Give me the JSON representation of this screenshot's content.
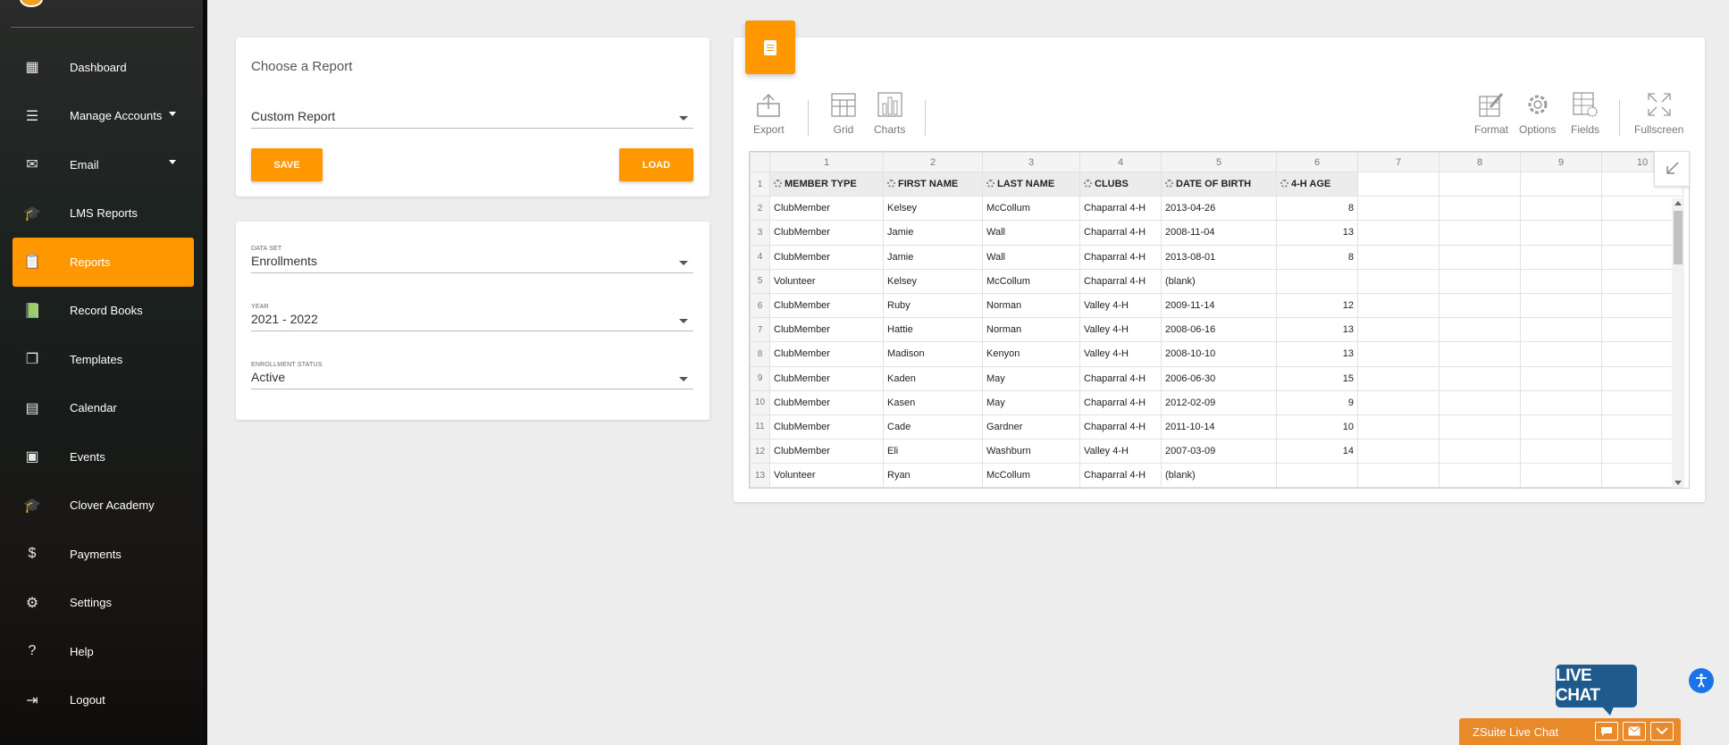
{
  "sidebar": {
    "items": [
      {
        "label": "Dashboard",
        "icon": "dashboard-icon"
      },
      {
        "label": "Manage Accounts",
        "icon": "list-icon",
        "has_caret": true
      },
      {
        "label": "Email",
        "icon": "mail-icon",
        "has_caret": true
      },
      {
        "label": "LMS Reports",
        "icon": "school-icon"
      },
      {
        "label": "Reports",
        "icon": "clipboard-icon",
        "active": true
      },
      {
        "label": "Record Books",
        "icon": "record-book-icon"
      },
      {
        "label": "Templates",
        "icon": "copy-icon"
      },
      {
        "label": "Calendar",
        "icon": "calendar-icon"
      },
      {
        "label": "Events",
        "icon": "event-icon"
      },
      {
        "label": "Clover Academy",
        "icon": "school-icon"
      },
      {
        "label": "Payments",
        "icon": "dollar-icon"
      },
      {
        "label": "Settings",
        "icon": "gear-icon"
      },
      {
        "label": "Help",
        "icon": "help-icon"
      },
      {
        "label": "Logout",
        "icon": "logout-icon"
      }
    ]
  },
  "choose": {
    "title": "Choose a Report",
    "selected": "Custom Report",
    "save_label": "SAVE",
    "load_label": "LOAD"
  },
  "filters": {
    "dataset_caption": "DATA SET",
    "dataset_value": "Enrollments",
    "year_caption": "YEAR",
    "year_value": "2021 - 2022",
    "status_caption": "ENROLLMENT STATUS",
    "status_value": "Active"
  },
  "toolbar": {
    "export": "Export",
    "grid": "Grid",
    "charts": "Charts",
    "format": "Format",
    "options": "Options",
    "fields": "Fields",
    "fullscreen": "Fullscreen"
  },
  "grid": {
    "col_numbers": [
      "1",
      "2",
      "3",
      "4",
      "5",
      "6",
      "7",
      "8",
      "9",
      "10"
    ],
    "headers": [
      "MEMBER TYPE",
      "FIRST NAME",
      "LAST NAME",
      "CLUBS",
      "DATE OF BIRTH",
      "4-H AGE"
    ],
    "rows": [
      {
        "n": "2",
        "c": [
          "ClubMember",
          "Kelsey",
          "McCollum",
          "Chaparral 4-H",
          "2013-04-26",
          "8"
        ]
      },
      {
        "n": "3",
        "c": [
          "ClubMember",
          "Jamie",
          "Wall",
          "Chaparral 4-H",
          "2008-11-04",
          "13"
        ]
      },
      {
        "n": "4",
        "c": [
          "ClubMember",
          "Jamie",
          "Wall",
          "Chaparral 4-H",
          "2013-08-01",
          "8"
        ]
      },
      {
        "n": "5",
        "c": [
          "Volunteer",
          "Kelsey",
          "McCollum",
          "Chaparral 4-H",
          "(blank)",
          ""
        ]
      },
      {
        "n": "6",
        "c": [
          "ClubMember",
          "Ruby",
          "Norman",
          "Valley 4-H",
          "2009-11-14",
          "12"
        ]
      },
      {
        "n": "7",
        "c": [
          "ClubMember",
          "Hattie",
          "Norman",
          "Valley 4-H",
          "2008-06-16",
          "13"
        ]
      },
      {
        "n": "8",
        "c": [
          "ClubMember",
          "Madison",
          "Kenyon",
          "Valley 4-H",
          "2008-10-10",
          "13"
        ]
      },
      {
        "n": "9",
        "c": [
          "ClubMember",
          "Kaden",
          "May",
          "Chaparral 4-H",
          "2006-06-30",
          "15"
        ]
      },
      {
        "n": "10",
        "c": [
          "ClubMember",
          "Kasen",
          "May",
          "Chaparral 4-H",
          "2012-02-09",
          "9"
        ]
      },
      {
        "n": "11",
        "c": [
          "ClubMember",
          "Cade",
          "Gardner",
          "Chaparral 4-H",
          "2011-10-14",
          "10"
        ]
      },
      {
        "n": "12",
        "c": [
          "ClubMember",
          "Eli",
          "Washburn",
          "Valley 4-H",
          "2007-03-09",
          "14"
        ]
      },
      {
        "n": "13",
        "c": [
          "Volunteer",
          "Ryan",
          "McCollum",
          "Chaparral 4-H",
          "(blank)",
          ""
        ]
      }
    ]
  },
  "livechat": {
    "bubble": "LIVE CHAT",
    "bar_title": "ZSuite Live Chat"
  },
  "colors": {
    "accent": "#ff9800",
    "chat_blue": "#1e5a8c",
    "chat_orange": "#e8892a"
  }
}
